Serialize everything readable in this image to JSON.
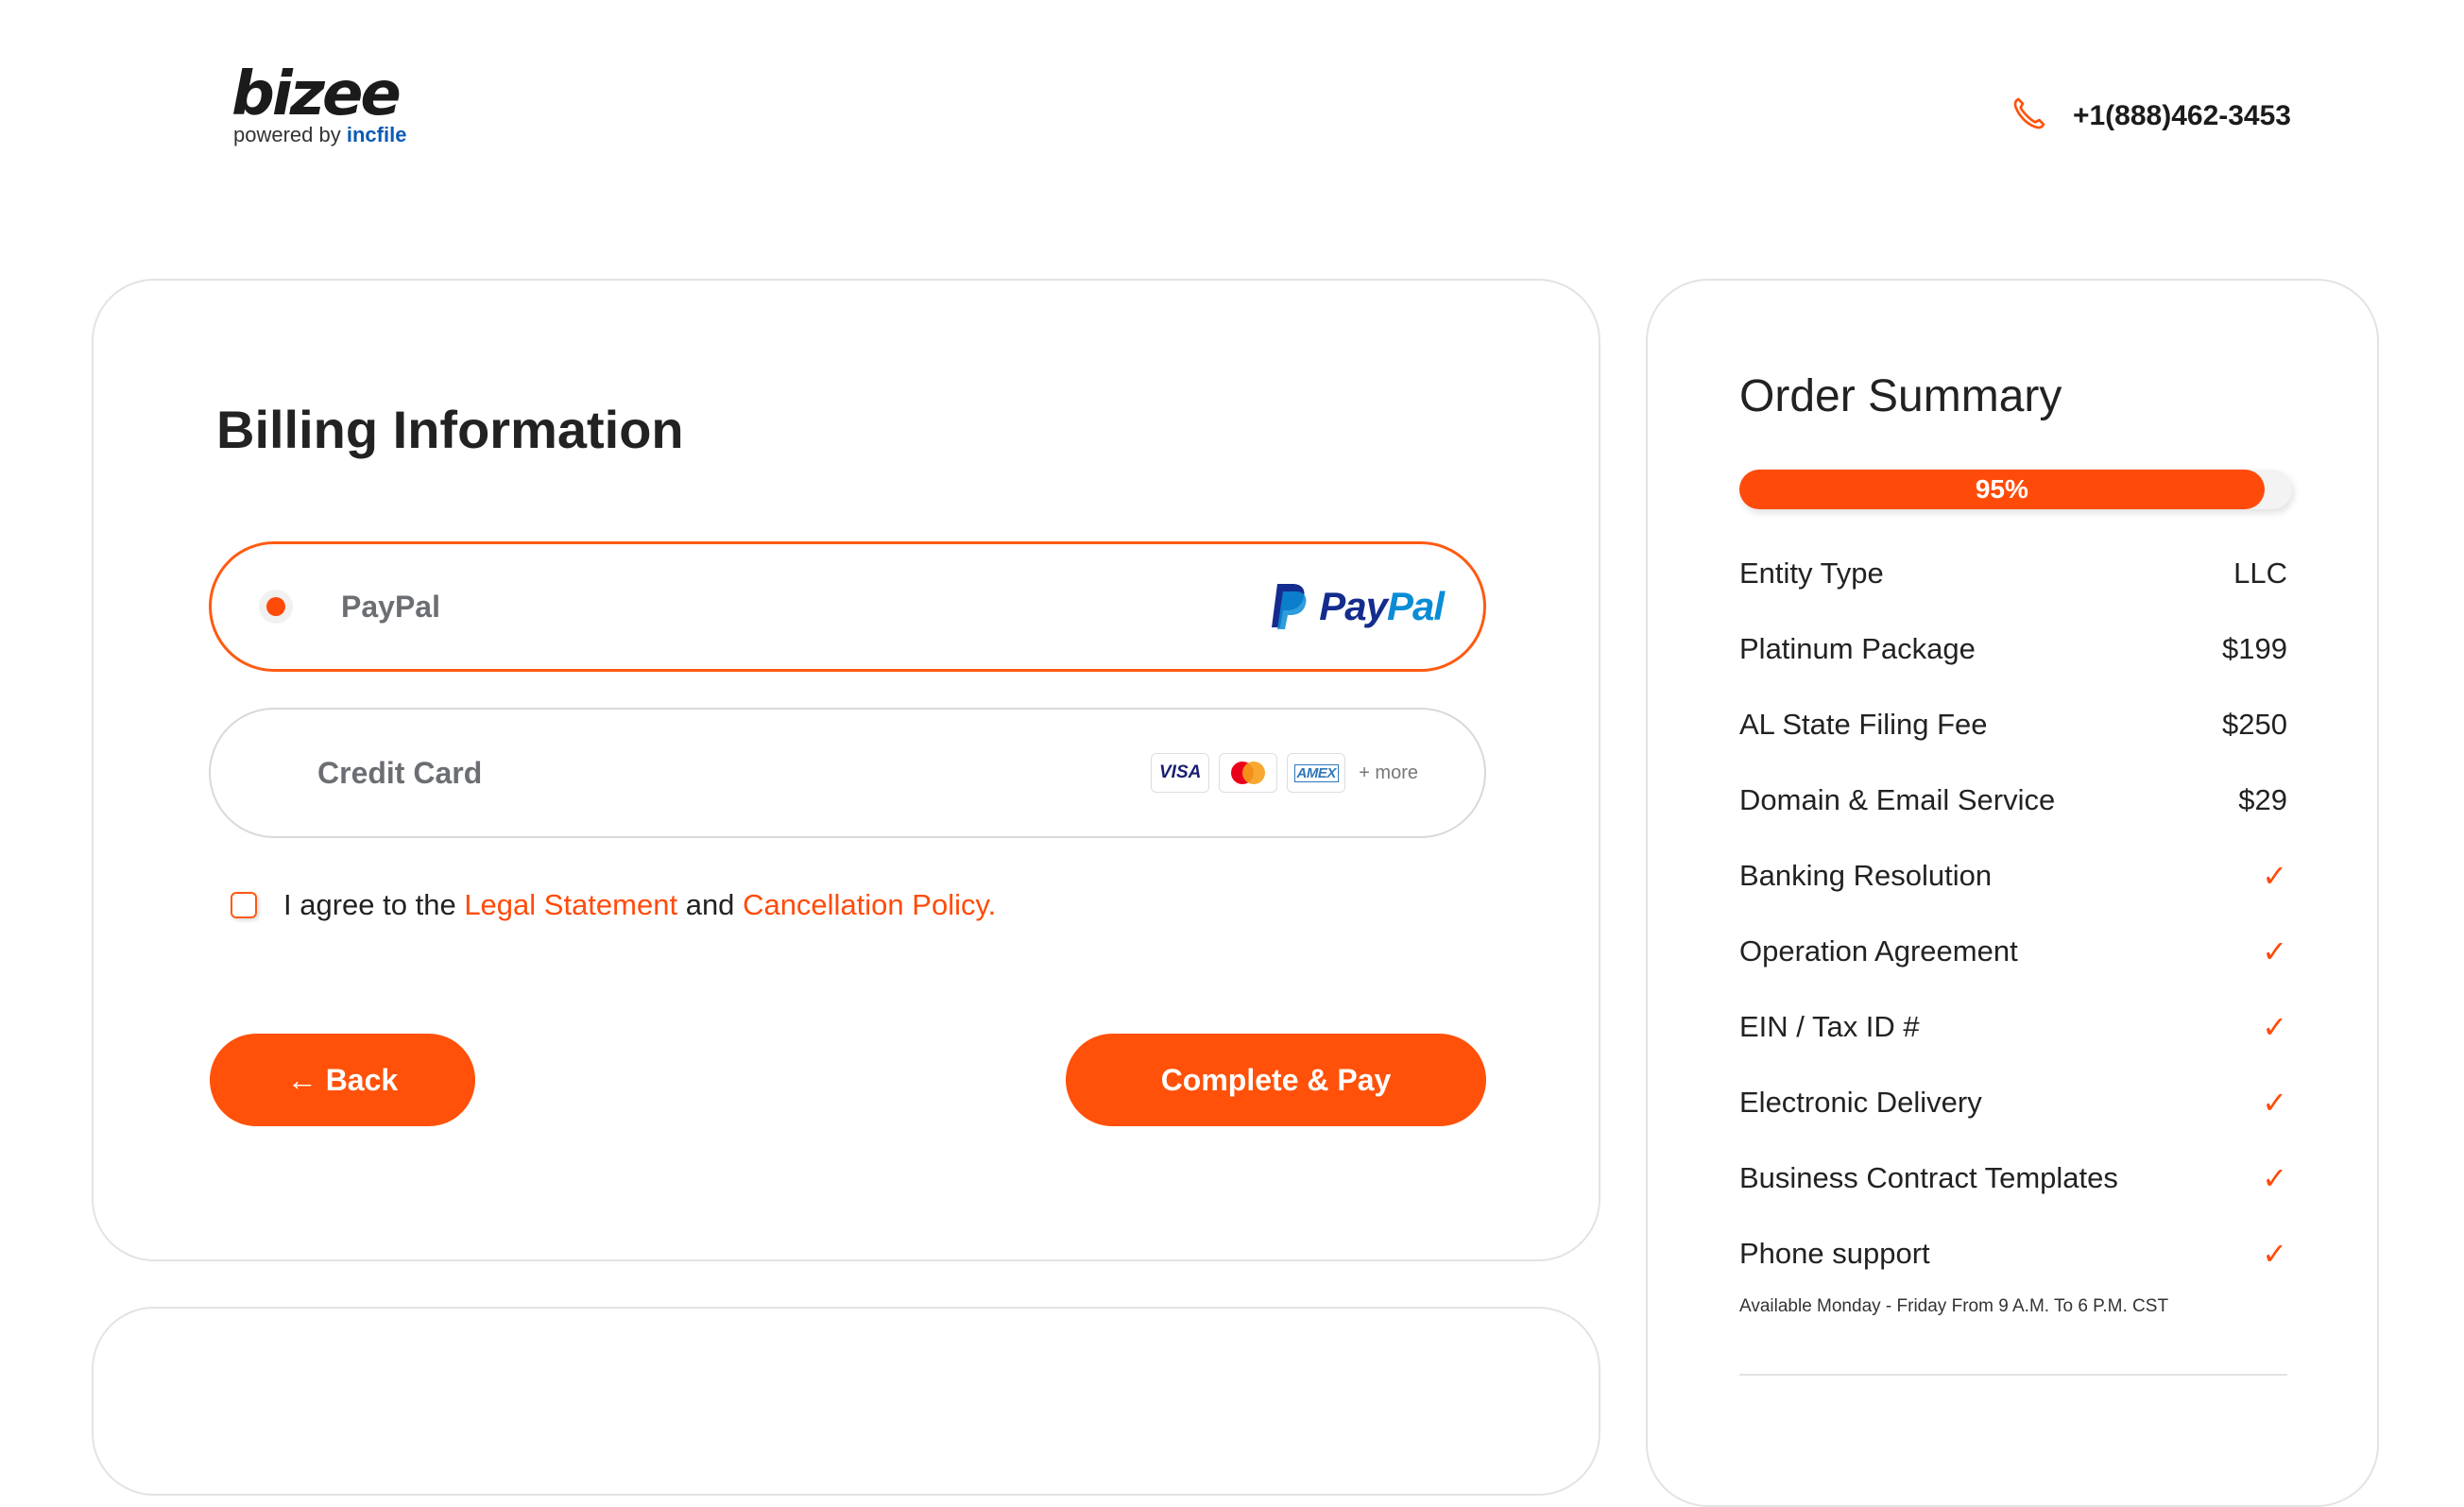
{
  "header": {
    "brand": "bizee",
    "powered_by": "powered by",
    "powered_brand": "incfile",
    "phone": "+1(888)462-3453",
    "phone_icon": "phone-icon"
  },
  "billing": {
    "title": "Billing Information",
    "options": [
      {
        "label": "PayPal",
        "selected": true,
        "logo_text_a": "Pay",
        "logo_text_b": "Pal"
      },
      {
        "label": "Credit Card",
        "selected": false,
        "card_visa": "VISA",
        "card_amex": "AMEX",
        "more": "+ more"
      }
    ],
    "agree": {
      "prefix": "I agree to the",
      "link1": "Legal Statement",
      "middle": "and",
      "link2": "Cancellation Policy."
    },
    "back_label": "← Back",
    "pay_label": "Complete & Pay"
  },
  "summary": {
    "title": "Order Summary",
    "progress_percent": 95,
    "progress_label": "95%",
    "items": [
      {
        "label": "Entity Type",
        "value": "LLC"
      },
      {
        "label": "Platinum Package",
        "value": "$199"
      },
      {
        "label": "AL State Filing Fee",
        "value": "$250"
      },
      {
        "label": "Domain & Email Service",
        "value": "$29"
      },
      {
        "label": "Banking Resolution",
        "value": "✓"
      },
      {
        "label": "Operation Agreement",
        "value": "✓"
      },
      {
        "label": "EIN / Tax ID #",
        "value": "✓"
      },
      {
        "label": "Electronic Delivery",
        "value": "✓"
      },
      {
        "label": "Business Contract Templates",
        "value": "✓"
      },
      {
        "label": "Phone support",
        "value": "✓"
      }
    ],
    "note": "Available Monday - Friday From 9 A.M. To 6 P.M. CST"
  },
  "colors": {
    "accent": "#ff5109",
    "paypal_dark": "#142c8e",
    "paypal_light": "#0a8cd6"
  }
}
